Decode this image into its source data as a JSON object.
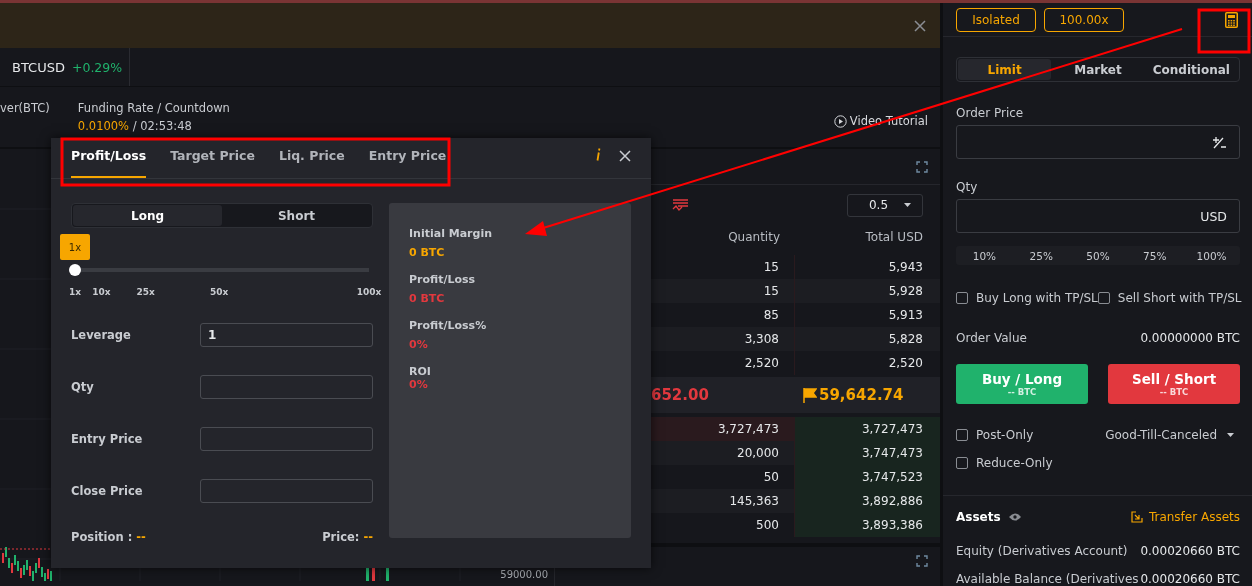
{
  "symbol_tab": {
    "symbol": "BTCUSD",
    "change": "+0.29%"
  },
  "stats": {
    "cut_label": "ver(BTC)",
    "funding_label": "Funding Rate / Countdown",
    "funding_rate": "0.0100%",
    "countdown": "/ 02:53:48"
  },
  "video_tutorial": "Video Tutorial",
  "chart": {
    "axis_label": "59000.00"
  },
  "order_book": {
    "depth": "0.5",
    "columns": [
      "Quantity",
      "Total USD"
    ],
    "asks": [
      {
        "quantity": "15",
        "total": "5,943"
      },
      {
        "quantity": "15",
        "total": "5,928"
      },
      {
        "quantity": "85",
        "total": "5,913"
      },
      {
        "quantity": "3,308",
        "total": "5,828"
      },
      {
        "quantity": "2,520",
        "total": "2,520"
      }
    ],
    "last_price": "652.00",
    "mark_price": "59,642.74",
    "bids": [
      {
        "quantity": "3,727,473",
        "total": "3,727,473"
      },
      {
        "quantity": "20,000",
        "total": "3,747,473"
      },
      {
        "quantity": "50",
        "total": "3,747,523"
      },
      {
        "quantity": "145,363",
        "total": "3,892,886"
      },
      {
        "quantity": "500",
        "total": "3,893,386"
      }
    ]
  },
  "calculator": {
    "tabs": [
      {
        "label": "Profit/Loss",
        "selected": true
      },
      {
        "label": "Target Price",
        "selected": false
      },
      {
        "label": "Liq. Price",
        "selected": false
      },
      {
        "label": "Entry Price",
        "selected": false
      }
    ],
    "sides": [
      {
        "label": "Long",
        "selected": true
      },
      {
        "label": "Short",
        "selected": false
      }
    ],
    "leverage_badge": "1x",
    "level": 0,
    "ticks": [
      "1x",
      "10x",
      "25x",
      "50x",
      "100x"
    ],
    "fields": [
      {
        "label": "Leverage",
        "value": "1"
      },
      {
        "label": "Qty"
      },
      {
        "label": "Entry Price"
      },
      {
        "label": "Close Price"
      }
    ],
    "position_label": "Position :",
    "position_value": "--",
    "price_label": "Price:",
    "price_value": "--",
    "results": [
      {
        "label": "Initial Margin",
        "value": "0 BTC",
        "color": "#f7a600"
      },
      {
        "label": "Profit/Loss",
        "value": "0 BTC",
        "color": "#e2383e"
      },
      {
        "label": "Profit/Loss%",
        "value": "0%",
        "color": "#e2383e"
      },
      {
        "label": "ROI",
        "value": "0%",
        "color": "#e2383e"
      }
    ]
  },
  "order_panel": {
    "margin_mode": "Isolated",
    "leverage": "100.00x",
    "order_types": [
      {
        "label": "Limit",
        "selected": true
      },
      {
        "label": "Market",
        "selected": false
      },
      {
        "label": "Conditional",
        "selected": false
      }
    ],
    "order_price_label": "Order Price",
    "qty_label": "Qty",
    "qty_unit": "USD",
    "percents": [
      "10%",
      "25%",
      "50%",
      "75%",
      "100%"
    ],
    "tpsl": [
      {
        "label": "Buy Long with TP/SL",
        "checked": false
      },
      {
        "label": "Sell Short with TP/SL",
        "checked": false
      }
    ],
    "order_value_label": "Order Value",
    "order_value": "0.00000000 BTC",
    "buy": {
      "title": "Buy / Long",
      "sub": "-- BTC"
    },
    "sell": {
      "title": "Sell / Short",
      "sub": "-- BTC"
    },
    "options": [
      {
        "label": "Post-Only",
        "checked": false
      },
      {
        "label": "Reduce-Only",
        "checked": false
      }
    ],
    "time_in_force": "Good-Till-Canceled",
    "assets_title": "Assets",
    "transfer": "Transfer Assets",
    "asset_rows": [
      {
        "label": "Equity (Derivatives Account)",
        "value": "0.00020660 BTC"
      },
      {
        "label": "Available Balance (Derivatives",
        "value": "0.00020660 BTC"
      }
    ]
  }
}
